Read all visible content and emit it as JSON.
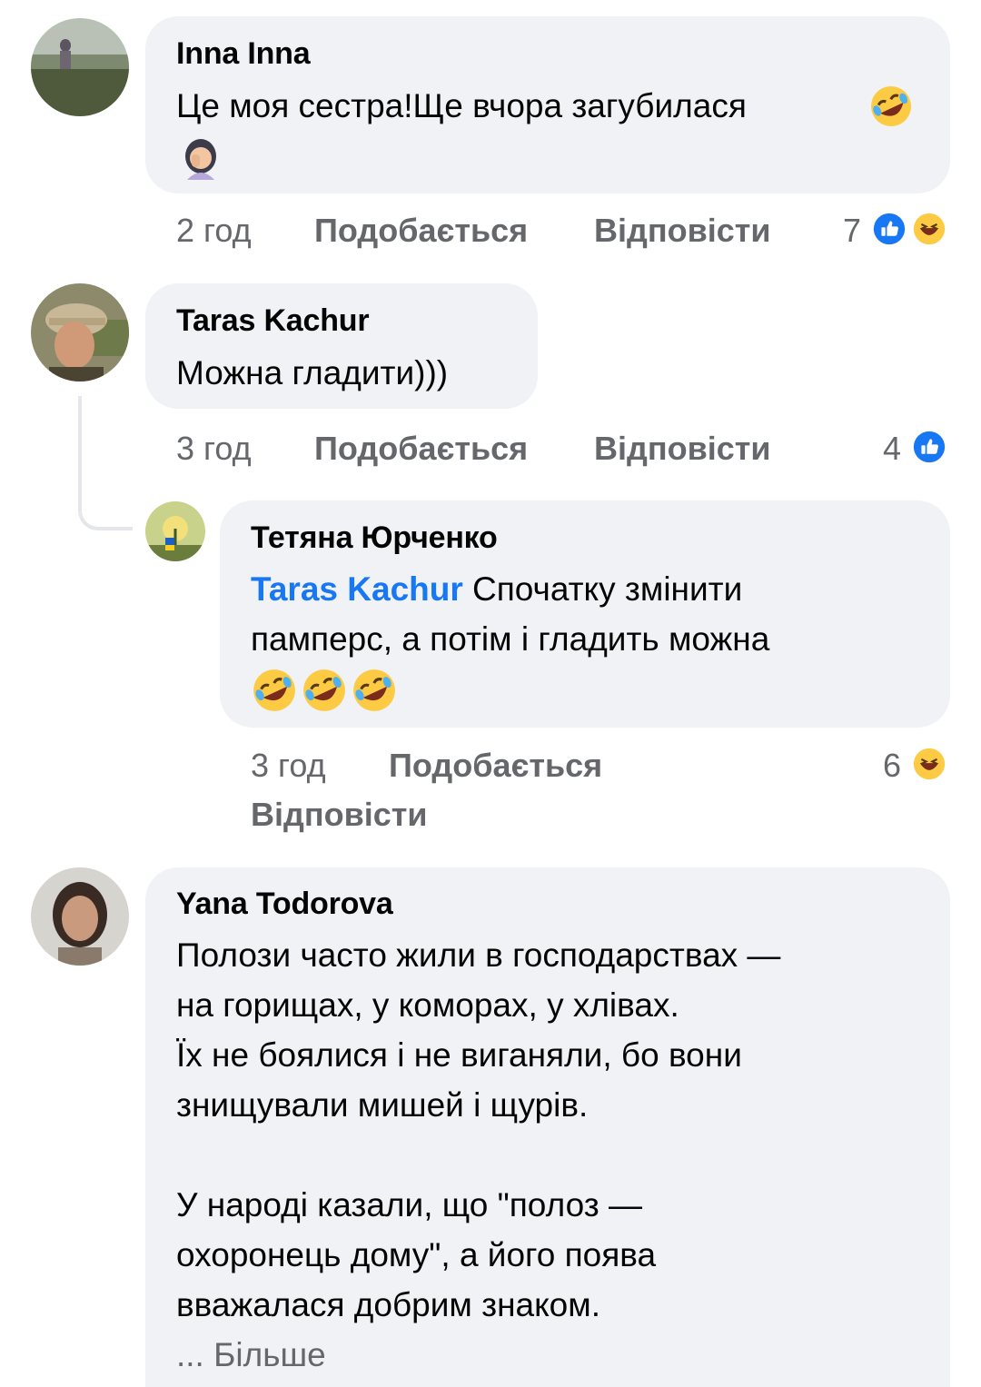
{
  "comments": [
    {
      "author": "Inna Inna",
      "text": "Це моя сестра!Ще вчора загубилася",
      "time": "2 год",
      "like_label": "Подобається",
      "reply_label": "Відповісти",
      "reaction_count": "7",
      "reactions": [
        "like-icon",
        "haha-icon"
      ]
    },
    {
      "author": "Taras Kachur",
      "text": "Можна гладити)))",
      "time": "3 год",
      "like_label": "Подобається",
      "reply_label": "Відповісти",
      "reaction_count": "4",
      "reactions": [
        "like-icon"
      ]
    },
    {
      "author": "Тетяна Юрченко",
      "mention": "Taras Kachur",
      "text_line1": "Спочатку змінити",
      "text_line2": "памперс, а потім і гладить можна",
      "time": "3 год",
      "like_label": "Подобається",
      "reply_label": "Відповісти",
      "reaction_count": "6",
      "reactions": [
        "haha-icon"
      ]
    },
    {
      "author": "Yana Todorova",
      "lines": [
        "Полози часто жили в господарствах —",
        "на горищах, у коморах, у хлівах.",
        "Їх не боялися і не виганяли, бо вони",
        "знищували мишей і щурів.",
        "",
        "У народі казали, що \"полоз —",
        "охоронець дому\", а його поява",
        "вважалася добрим знаком."
      ],
      "more_label": "... Більше"
    }
  ],
  "colors": {
    "bubble": "#f0f2f5",
    "meta": "#65676b",
    "mention": "#1877f2",
    "like": "#1877f2",
    "haha": "#fcca43"
  }
}
